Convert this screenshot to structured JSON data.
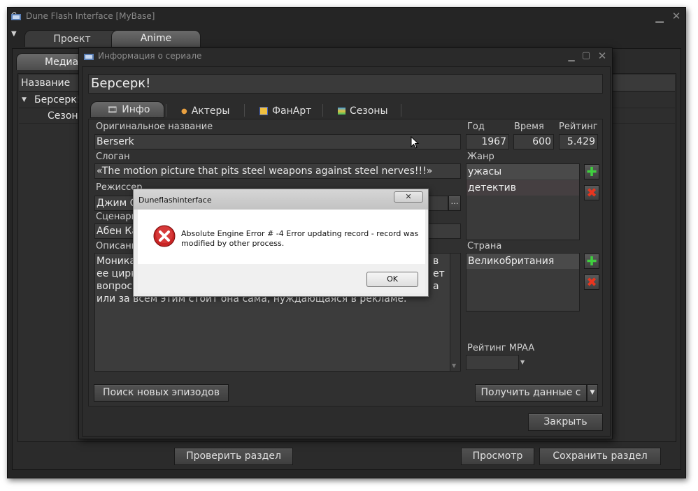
{
  "main_window": {
    "title": "Dune Flash Interface [MyBase]"
  },
  "main_tabs": [
    {
      "label": "Проект"
    },
    {
      "label": "Anime"
    }
  ],
  "sub_tab": {
    "label": "Медиат"
  },
  "tree": {
    "column_header": "Название",
    "root_item": "Берсерк!",
    "child_item": "Сезон"
  },
  "bottom_buttons": {
    "check_section": "Проверить раздел",
    "view": "Просмотр",
    "save_section": "Сохранить раздел"
  },
  "series_dialog": {
    "title": "Информация о сериале",
    "series_title": "Берсерк!",
    "tabs": [
      {
        "label": "Инфо"
      },
      {
        "label": "Актеры"
      },
      {
        "label": "ФанАрт"
      },
      {
        "label": "Сезоны"
      }
    ],
    "original_name": {
      "label": "Оригинальное название",
      "value": "Berserk"
    },
    "slogan": {
      "label": "Слоган",
      "value": "«The motion picture that pits steel weapons against steel nerves!!!»"
    },
    "director": {
      "label": "Режиссер",
      "value": "Джим С"
    },
    "writer": {
      "label": "Сценарий",
      "value": "Абен Ка"
    },
    "description": {
      "label": "Описание",
      "line1_left": "Моника",
      "line1_right": "в",
      "line2_left": "ее цирк",
      "line2_right": "ет",
      "line3_left": "вопрос:",
      "line3_right": "а",
      "line4": "или за всем этим стоит она сама, нуждающаяся в рекламе."
    },
    "year": {
      "label": "Год",
      "value": "1967"
    },
    "duration": {
      "label": "Время",
      "value": "600"
    },
    "rating": {
      "label": "Рейтинг",
      "value": "5.429"
    },
    "genre": {
      "label": "Жанр",
      "items": [
        "ужасы",
        "детектив"
      ]
    },
    "country": {
      "label": "Страна",
      "items": [
        "Великобритания"
      ]
    },
    "mpaa": {
      "label": "Рейтинг MPAA",
      "value": ""
    },
    "search_episodes_button": "Поиск новых эпизодов",
    "get_data_button": "Получить данные с",
    "close_button": "Закрыть"
  },
  "error_dialog": {
    "title": "Duneflashinterface",
    "message_line1": "Absolute Engine Error # -4 Error updating record - record was",
    "message_line2": "modified by other process.",
    "ok_button": "OK"
  },
  "colors": {
    "background": "#252525",
    "panel": "#2f2f2f",
    "field": "#3c3c3c",
    "add_green": "#3fcf3f",
    "remove_red": "#d8321f"
  }
}
